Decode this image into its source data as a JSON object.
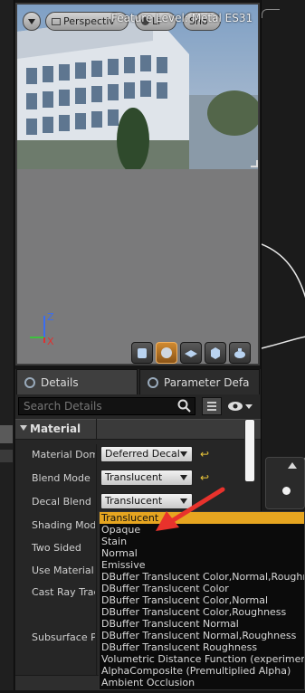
{
  "viewport": {
    "toolbar": {
      "perspective_label": "Perspectiv",
      "lit_label": "Li",
      "show_label": "Sho"
    },
    "feature_level": "Feature Level:  Metal ES31",
    "axis": {
      "z": "Z",
      "x": "X"
    }
  },
  "details_panel": {
    "tabs": [
      {
        "label": "Details"
      },
      {
        "label": "Parameter Defa"
      }
    ],
    "search_placeholder": "Search Details",
    "category": "Material",
    "properties": [
      {
        "label": "Material Doma",
        "value": "Deferred Decal"
      },
      {
        "label": "Blend Mode",
        "value": "Translucent"
      },
      {
        "label": "Decal Blend M",
        "value": "Translucent"
      },
      {
        "label": "Shading Mode"
      },
      {
        "label": "Two Sided"
      },
      {
        "label": "Use Material A"
      },
      {
        "label": "Cast Ray Trac"
      },
      {
        "label": "Subsurface Pr"
      }
    ]
  },
  "dropdown": {
    "selected": "Translucent",
    "options": [
      "Translucent",
      "Opaque",
      "Stain",
      "Normal",
      "Emissive",
      "DBuffer Translucent Color,Normal,Roughness",
      "DBuffer Translucent Color",
      "DBuffer Translucent Color,Normal",
      "DBuffer Translucent Color,Roughness",
      "DBuffer Translucent Normal",
      "DBuffer Translucent Normal,Roughness",
      "DBuffer Translucent Roughness",
      "Volumetric Distance Function (experimental)",
      "AlphaComposite (Premultiplied Alpha)",
      "Ambient Occlusion"
    ]
  },
  "colors": {
    "accent": "#e6a520",
    "annotation_arrow": "#e8322c"
  }
}
